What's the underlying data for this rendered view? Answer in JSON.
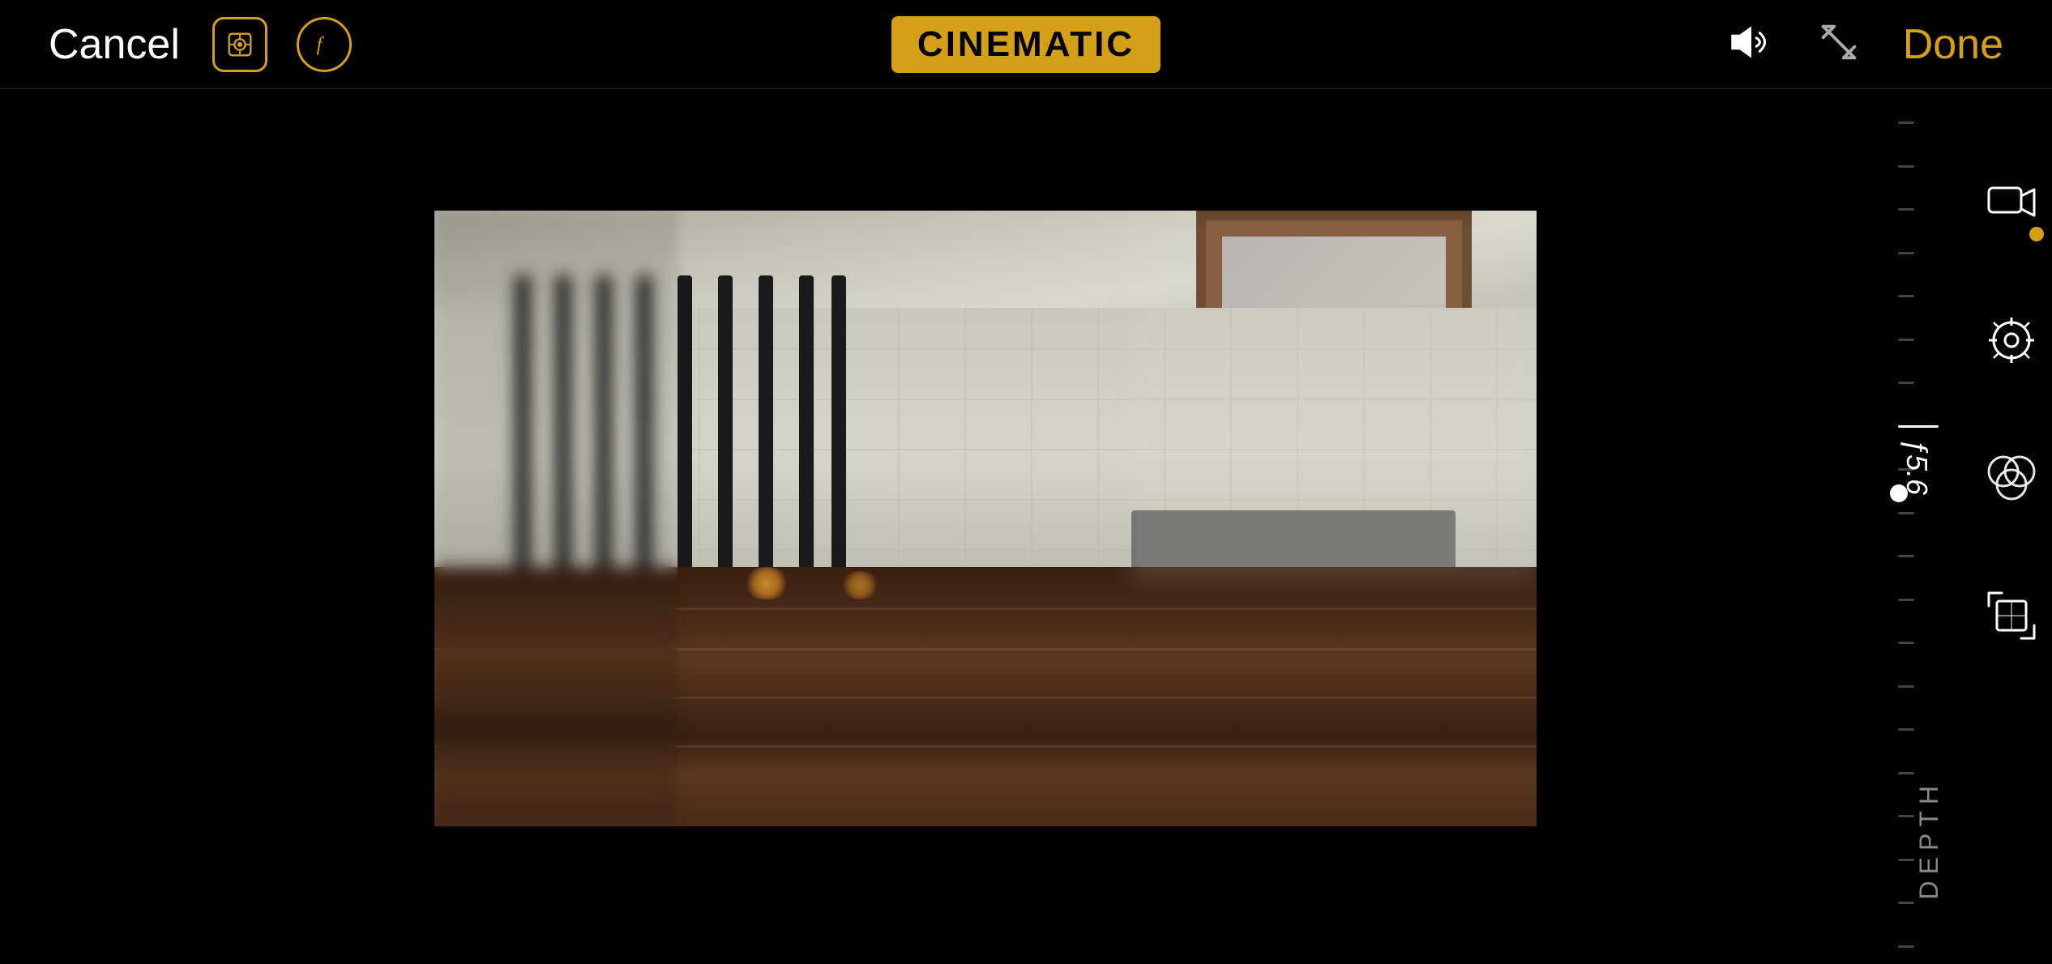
{
  "header": {
    "cancel_label": "Cancel",
    "done_label": "Done",
    "cinematic_label": "CINEMATIC",
    "depth_label": "DEPTH",
    "fstop_label": "ƒ5.6"
  },
  "toolbar": {
    "focus_icon": "focus-reticle-icon",
    "aperture_icon": "aperture-f-icon",
    "volume_icon": "volume-icon",
    "resize_icon": "resize-diagonal-icon",
    "video_icon": "video-camera-icon",
    "exposure_icon": "exposure-icon",
    "color_mix_icon": "color-mix-icon",
    "crop_icon": "crop-icon"
  },
  "slider": {
    "fstop_value": "ƒ5.6",
    "ticks": 20
  }
}
